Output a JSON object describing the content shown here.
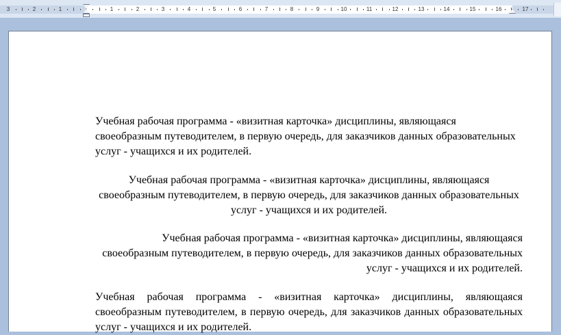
{
  "ruler": {
    "left_labels": [
      "3",
      "2",
      "1"
    ],
    "right_labels": [
      "1",
      "2",
      "3",
      "4",
      "5",
      "6",
      "7",
      "8",
      "9",
      "10",
      "11",
      "12",
      "13",
      "14",
      "15",
      "16",
      "17"
    ]
  },
  "document": {
    "paragraphs": [
      {
        "alignment": "left",
        "text": "Учебная рабочая программа - «визитная карточка» дисциплины, являющаяся своеобразным путеводителем, в первую очередь, для заказчиков данных образовательных услуг - учащихся и их родителей."
      },
      {
        "alignment": "center",
        "text": "Учебная рабочая программа - «визитная карточка» дисциплины, являющаяся своеобразным путеводителем, в первую очередь, для заказчиков данных образовательных услуг - учащихся и их родителей."
      },
      {
        "alignment": "right",
        "text": "Учебная рабочая программа - «визитная карточка» дисциплины, являющаяся своеобразным путеводителем, в первую очередь, для заказчиков данных образовательных услуг - учащихся и их родителей."
      },
      {
        "alignment": "justify",
        "text": "Учебная рабочая программа - «визитная карточка» дисциплины, являющаяся своеобразным путеводителем, в первую очередь, для заказчиков данных образовательных услуг - учащихся и их родителей."
      }
    ]
  }
}
